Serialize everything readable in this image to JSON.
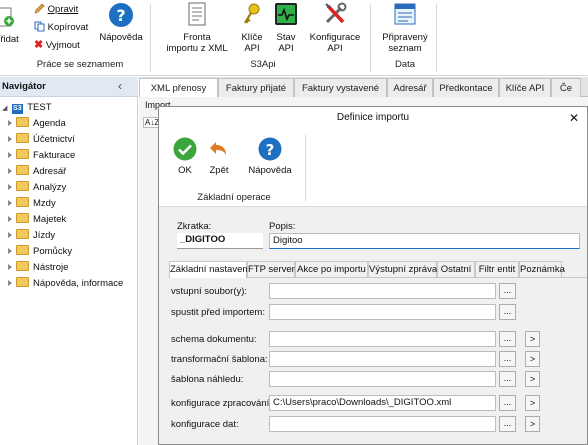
{
  "ribbon": {
    "pridat": "Přidat",
    "opravit": "Opravit",
    "kopirovat": "Kopírovat",
    "vyjmout": "Vyjmout",
    "napoveda": "Nápověda",
    "group1": "Práce se seznamem",
    "fronta1": "Fronta",
    "fronta2": "importu z XML",
    "klice1": "Klíče",
    "klice2": "API",
    "stav1": "Stav",
    "stav2": "API",
    "konf1": "Konfigurace",
    "konf2": "API",
    "group2": "S3Api",
    "prip1": "Připravený",
    "prip2": "seznam",
    "group3": "Data"
  },
  "nav": {
    "title": "Navigátor",
    "collapse": "‹",
    "root": "TEST",
    "root_badge": "S3",
    "items": [
      "Agenda",
      "Účetnictví",
      "Fakturace",
      "Adresář",
      "Analýzy",
      "Mzdy",
      "Majetek",
      "Jízdy",
      "Pomůcky",
      "Nástroje",
      "Nápověda, informace"
    ]
  },
  "tabs": [
    "XML přenosy",
    "Faktury přijaté",
    "Faktury vystavené",
    "Adresář",
    "Předkontace",
    "Klíče API",
    "Če"
  ],
  "under": {
    "label": "Import",
    "sort": "A↓Z"
  },
  "dialog": {
    "title": "Definice importu",
    "ok": "OK",
    "zpet": "Zpět",
    "napoveda": "Nápověda",
    "group": "Základní operace",
    "zkratka_label": "Zkratka:",
    "zkratka_value": "_DIGITOO",
    "popis_label": "Popis:",
    "popis_value": "Digitoo",
    "inner_tabs": [
      "Základní nastavení",
      "FTP server",
      "Akce po importu",
      "Výstupní zpráva",
      "Ostatní",
      "Filtr entit",
      "Poznámka"
    ],
    "fields": [
      {
        "label": "vstupní soubor(y):",
        "value": "",
        "arrow": false
      },
      {
        "label": "spustit před importem:",
        "value": "",
        "arrow": false
      },
      {
        "label": "schema dokumentu:",
        "value": "",
        "arrow": true
      },
      {
        "label": "transformační šablona:",
        "value": "",
        "arrow": true
      },
      {
        "label": "šablona náhledu:",
        "value": "",
        "arrow": true
      },
      {
        "label": "konfigurace zpracování:",
        "value": "C:\\Users\\praco\\Downloads\\_DIGITOO.xml",
        "arrow": true
      },
      {
        "label": "konfigurace dat:",
        "value": "",
        "arrow": true
      }
    ],
    "dots": "...",
    "arrow": ">"
  },
  "colors": {
    "accent": "#1e6fc2",
    "ok_green": "#3aa53a",
    "folder": "#f0c95a"
  }
}
